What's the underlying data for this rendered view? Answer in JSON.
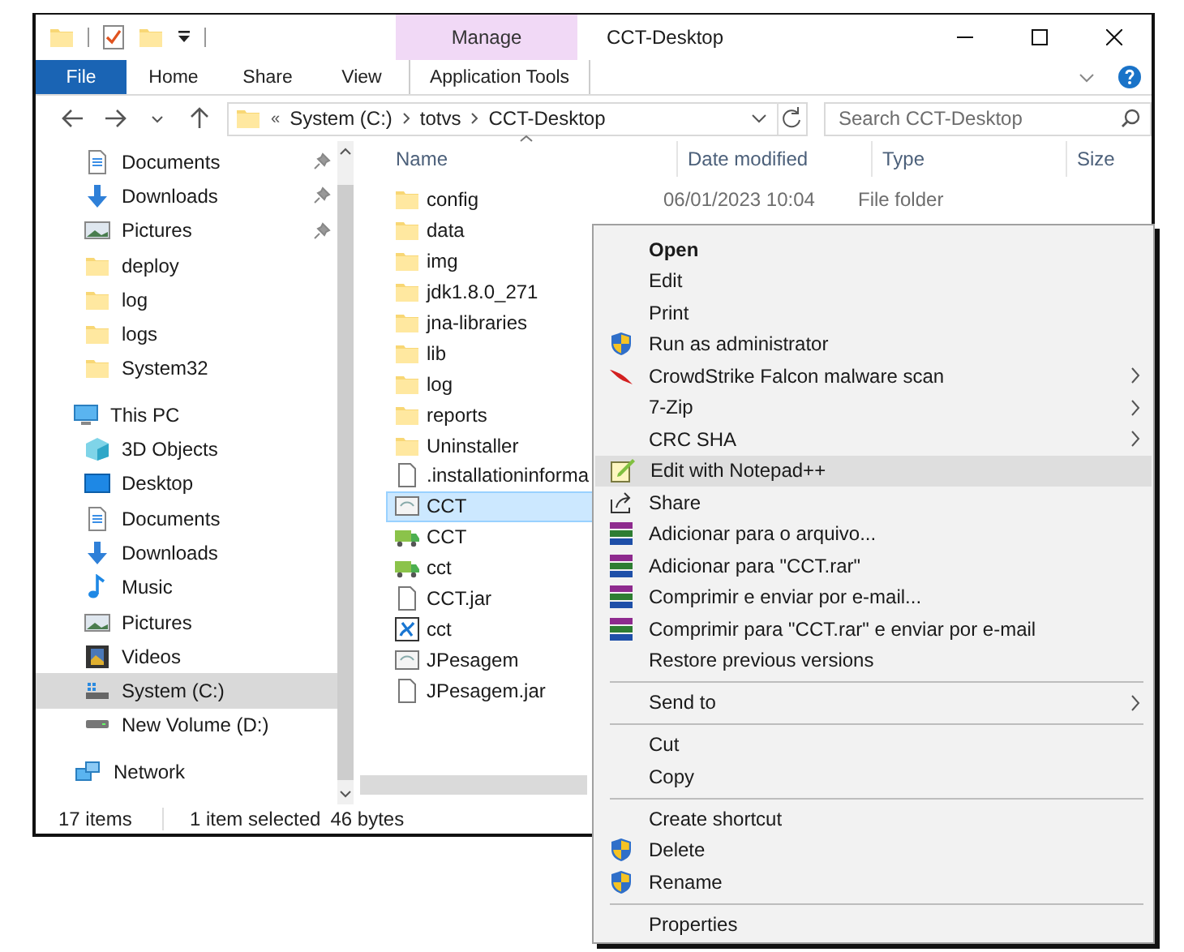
{
  "window": {
    "title": "CCT-Desktop",
    "context_tab": "Manage"
  },
  "ribbon_tabs": [
    {
      "label": "File",
      "kind": "file",
      "selected": false
    },
    {
      "label": "Home",
      "kind": "plain",
      "selected": false
    },
    {
      "label": "Share",
      "kind": "plain",
      "selected": false
    },
    {
      "label": "View",
      "kind": "plain",
      "selected": false
    },
    {
      "label": "Application Tools",
      "kind": "plain",
      "selected": true
    }
  ],
  "address_bar": {
    "overflow": "«",
    "path": [
      "System (C:)",
      "totvs",
      "CCT-Desktop"
    ]
  },
  "search": {
    "placeholder": "Search CCT-Desktop"
  },
  "quick_access": [
    {
      "label": "Documents",
      "kind": "documents",
      "pinned": true,
      "selected": false
    },
    {
      "label": "Downloads",
      "kind": "downloads",
      "pinned": true,
      "selected": false
    },
    {
      "label": "Pictures",
      "kind": "pictures",
      "pinned": true,
      "selected": false
    },
    {
      "label": "deploy",
      "kind": "folder",
      "pinned": false,
      "selected": false
    },
    {
      "label": "log",
      "kind": "folder",
      "pinned": false,
      "selected": false
    },
    {
      "label": "logs",
      "kind": "folder",
      "pinned": false,
      "selected": false
    },
    {
      "label": "System32",
      "kind": "folder",
      "pinned": false,
      "selected": false
    }
  ],
  "tree": [
    {
      "label": "This PC",
      "kind": "pc",
      "selected": false,
      "children": [
        {
          "label": "3D Objects",
          "kind": "cube",
          "selected": false
        },
        {
          "label": "Desktop",
          "kind": "desktop",
          "selected": false
        },
        {
          "label": "Documents",
          "kind": "documents",
          "selected": false
        },
        {
          "label": "Downloads",
          "kind": "downloads",
          "selected": false
        },
        {
          "label": "Music",
          "kind": "music",
          "selected": false
        },
        {
          "label": "Pictures",
          "kind": "pictures",
          "selected": false
        },
        {
          "label": "Videos",
          "kind": "videos",
          "selected": false
        },
        {
          "label": "System (C:)",
          "kind": "drive-c",
          "selected": true
        },
        {
          "label": "New Volume (D:)",
          "kind": "drive",
          "selected": false
        }
      ]
    },
    {
      "label": "Network",
      "kind": "network",
      "selected": false
    }
  ],
  "table": {
    "columns": [
      "Name",
      "Date modified",
      "Type",
      "Size"
    ],
    "rows": [
      {
        "name": "config",
        "kind": "folder",
        "date": "06/01/2023 10:04",
        "type": "File folder",
        "selected": false
      },
      {
        "name": "data",
        "kind": "folder",
        "selected": false
      },
      {
        "name": "img",
        "kind": "folder",
        "selected": false
      },
      {
        "name": "jdk1.8.0_271",
        "kind": "folder",
        "selected": false
      },
      {
        "name": "jna-libraries",
        "kind": "folder",
        "selected": false
      },
      {
        "name": "lib",
        "kind": "folder",
        "selected": false
      },
      {
        "name": "log",
        "kind": "folder",
        "selected": false
      },
      {
        "name": "reports",
        "kind": "folder",
        "selected": false
      },
      {
        "name": "Uninstaller",
        "kind": "folder",
        "selected": false
      },
      {
        "name": ".installationinforma",
        "kind": "file",
        "selected": false
      },
      {
        "name": "CCT",
        "kind": "app",
        "selected": true
      },
      {
        "name": "CCT",
        "kind": "truck",
        "selected": false
      },
      {
        "name": "cct",
        "kind": "truck",
        "selected": false
      },
      {
        "name": "CCT.jar",
        "kind": "file",
        "selected": false
      },
      {
        "name": "cct",
        "kind": "java",
        "selected": false
      },
      {
        "name": "JPesagem",
        "kind": "app",
        "selected": false
      },
      {
        "name": "JPesagem.jar",
        "kind": "file",
        "selected": false
      }
    ]
  },
  "status_bar": {
    "count": "17 items",
    "selection": "1 item selected",
    "size": "46 bytes"
  },
  "context_menu": [
    {
      "kind": "plain",
      "label": "Open",
      "default": true,
      "submenu": false,
      "hovered": false
    },
    {
      "kind": "plain",
      "label": "Edit",
      "default": false,
      "submenu": false,
      "hovered": false
    },
    {
      "kind": "plain",
      "label": "Print",
      "default": false,
      "submenu": false,
      "hovered": false
    },
    {
      "kind": "shield",
      "label": "Run as administrator",
      "default": false,
      "submenu": false,
      "hovered": false
    },
    {
      "kind": "falcon",
      "label": "CrowdStrike Falcon malware scan",
      "default": false,
      "submenu": true,
      "hovered": false
    },
    {
      "kind": "plain",
      "label": "7-Zip",
      "default": false,
      "submenu": true,
      "hovered": false
    },
    {
      "kind": "plain",
      "label": "CRC SHA",
      "default": false,
      "submenu": true,
      "hovered": false
    },
    {
      "kind": "notepad",
      "label": "Edit with Notepad++",
      "default": false,
      "submenu": false,
      "hovered": true
    },
    {
      "kind": "share",
      "label": "Share",
      "default": false,
      "submenu": false,
      "hovered": false
    },
    {
      "kind": "books",
      "label": "Adicionar para o arquivo...",
      "default": false,
      "submenu": false,
      "hovered": false
    },
    {
      "kind": "books",
      "label": "Adicionar para \"CCT.rar\"",
      "default": false,
      "submenu": false,
      "hovered": false
    },
    {
      "kind": "books",
      "label": "Comprimir e enviar por e-mail...",
      "default": false,
      "submenu": false,
      "hovered": false
    },
    {
      "kind": "books",
      "label": "Comprimir para \"CCT.rar\" e enviar por e-mail",
      "default": false,
      "submenu": false,
      "hovered": false
    },
    {
      "kind": "plain",
      "label": "Restore previous versions",
      "default": false,
      "submenu": false,
      "hovered": false
    },
    {
      "kind": "separator"
    },
    {
      "kind": "plain",
      "label": "Send to",
      "default": false,
      "submenu": true,
      "hovered": false
    },
    {
      "kind": "separator"
    },
    {
      "kind": "plain",
      "label": "Cut",
      "default": false,
      "submenu": false,
      "hovered": false
    },
    {
      "kind": "plain",
      "label": "Copy",
      "default": false,
      "submenu": false,
      "hovered": false
    },
    {
      "kind": "separator"
    },
    {
      "kind": "plain",
      "label": "Create shortcut",
      "default": false,
      "submenu": false,
      "hovered": false
    },
    {
      "kind": "shield",
      "label": "Delete",
      "default": false,
      "submenu": false,
      "hovered": false
    },
    {
      "kind": "shield",
      "label": "Rename",
      "default": false,
      "submenu": false,
      "hovered": false
    },
    {
      "kind": "separator"
    },
    {
      "kind": "plain",
      "label": "Properties",
      "default": false,
      "submenu": false,
      "hovered": false
    }
  ]
}
